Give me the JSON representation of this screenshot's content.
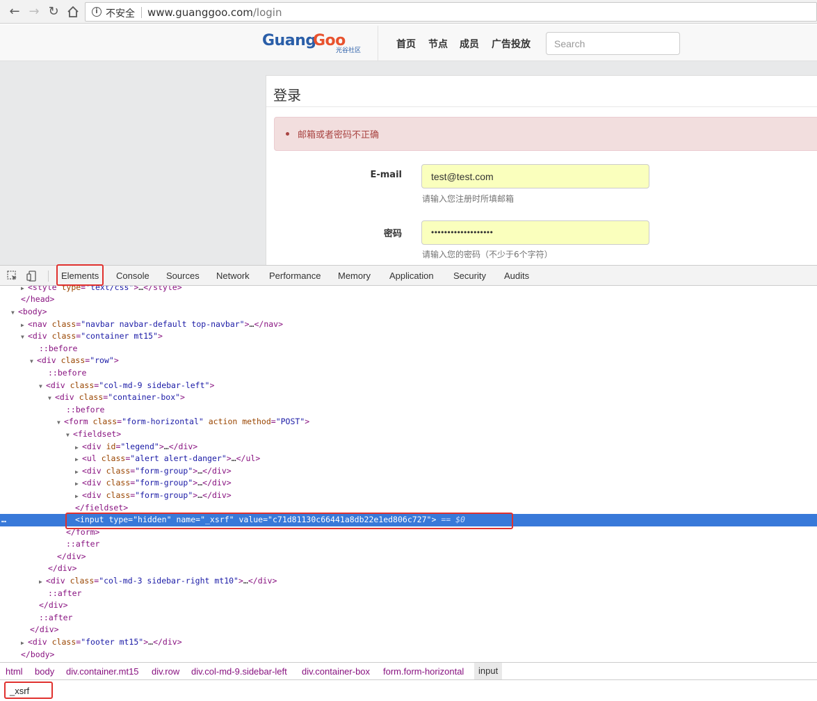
{
  "browser": {
    "security_label": "不安全",
    "url_host": "www.guanggoo.com",
    "url_path": "/login"
  },
  "site": {
    "logo_text": "GuangGoo",
    "logo_subtext": "光谷社区",
    "menu": [
      "首页",
      "节点",
      "成员",
      "广告投放"
    ],
    "search_placeholder": "Search",
    "login_title": "登录",
    "alert_message": "邮箱或者密码不正确",
    "email_label": "E-mail",
    "email_value": "test@test.com",
    "email_help": "请输入您注册时所填邮箱",
    "password_label": "密码",
    "password_value": "•••••••••••••••••••",
    "password_help": "请输入您的密码（不少于6个字符）"
  },
  "devtools": {
    "tabs": [
      "Elements",
      "Console",
      "Sources",
      "Network",
      "Performance",
      "Memory",
      "Application",
      "Security",
      "Audits"
    ],
    "active_tab": "Elements",
    "selected_suffix": "== $0",
    "breadcrumbs": [
      "html",
      "body",
      "div.container.mt15",
      "div.row",
      "div.col-md-9.sidebar-left",
      "div.container-box",
      "form.form-horizontal",
      "input"
    ],
    "search_query": "_xsrf"
  },
  "colors": {
    "selection": "#3879d9",
    "highlight_box": "#e0312e",
    "alert_bg": "#f2dede",
    "autofill": "#faffbd"
  }
}
